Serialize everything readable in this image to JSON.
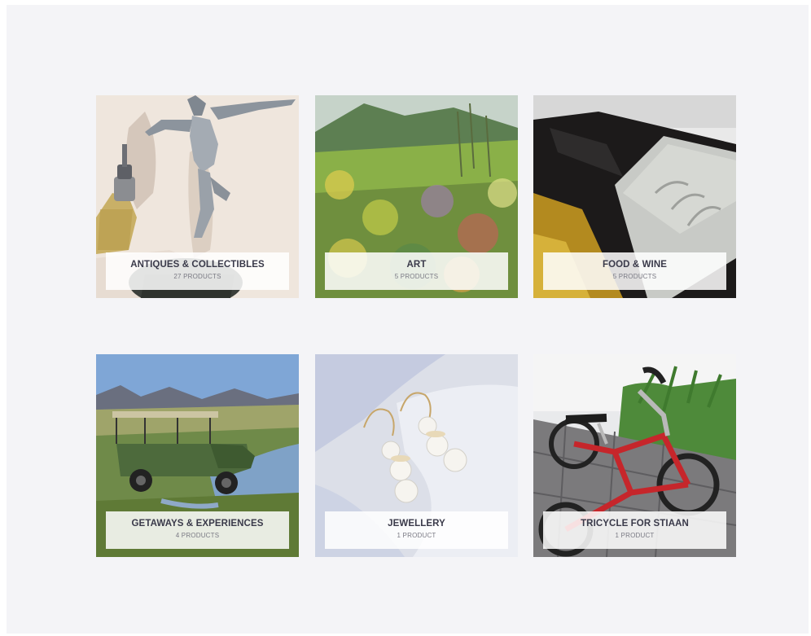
{
  "categories": [
    {
      "name": "ANTIQUES & COLLECTIBLES",
      "count": "27 PRODUCTS",
      "image": "figurine-sculpture-photo"
    },
    {
      "name": "ART",
      "count": "5 PRODUCTS",
      "image": "landscape-painting-photo"
    },
    {
      "name": "FOOD & WINE",
      "count": "5 PRODUCTS",
      "image": "wine-bottle-photo"
    },
    {
      "name": "GETAWAYS & EXPERIENCES",
      "count": "4 PRODUCTS",
      "image": "safari-vehicle-photo"
    },
    {
      "name": "JEWELLERY",
      "count": "1 PRODUCT",
      "image": "pearl-earrings-photo"
    },
    {
      "name": "TRICYCLE FOR STIAAN",
      "count": "1 PRODUCT",
      "image": "red-tricycle-photo"
    }
  ]
}
